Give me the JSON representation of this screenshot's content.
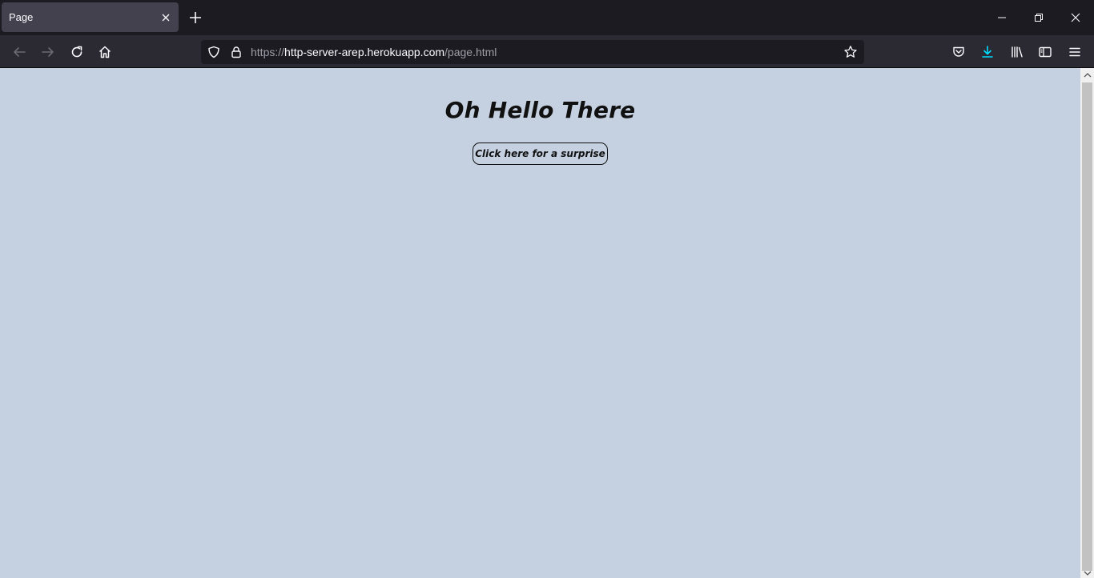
{
  "browser": {
    "tab": {
      "title": "Page"
    },
    "url": {
      "scheme": "https://",
      "host": "http-server-arep.herokuapp.com",
      "path": "/page.html"
    },
    "colors": {
      "chrome": "#1c1b22",
      "toolbar": "#2b2a33",
      "tab_active": "#42414d",
      "download_accent": "#00ddff"
    }
  },
  "icons": {
    "tab_close": "close-icon",
    "new_tab": "plus-icon",
    "minimize": "minimize-icon",
    "restore": "restore-icon",
    "close_window": "close-icon",
    "back": "arrow-left-icon",
    "forward": "arrow-right-icon",
    "reload": "reload-icon",
    "home": "home-icon",
    "tracking": "shield-icon",
    "lock": "lock-icon",
    "bookmark": "star-icon",
    "pocket": "pocket-icon",
    "downloads": "download-icon",
    "library": "library-icon",
    "sidebar": "sidebar-icon",
    "menu": "hamburger-menu-icon"
  },
  "page": {
    "heading": "Oh Hello There",
    "button_label": "Click here for a surprise",
    "background": "#c5d1e1"
  }
}
